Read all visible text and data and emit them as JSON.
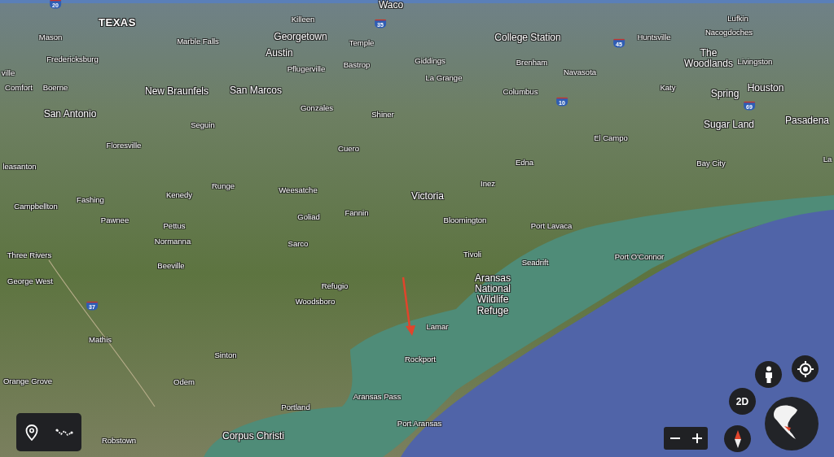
{
  "map": {
    "labels": [
      {
        "text": "TEXAS",
        "kind": "state"
      },
      {
        "text": "Waco",
        "kind": "major"
      },
      {
        "text": "Killeen",
        "kind": "city"
      },
      {
        "text": "Mason",
        "kind": "city"
      },
      {
        "text": "Marble Falls",
        "kind": "city"
      },
      {
        "text": "Georgetown",
        "kind": "major"
      },
      {
        "text": "Temple",
        "kind": "city"
      },
      {
        "text": "Austin",
        "kind": "major"
      },
      {
        "text": "Fredericksburg",
        "kind": "city"
      },
      {
        "text": "Pflugerville",
        "kind": "city"
      },
      {
        "text": "Bastrop",
        "kind": "city"
      },
      {
        "text": "ville",
        "kind": "city"
      },
      {
        "text": "Comfort",
        "kind": "city"
      },
      {
        "text": "Boerne",
        "kind": "city"
      },
      {
        "text": "New Braunfels",
        "kind": "major"
      },
      {
        "text": "San Marcos",
        "kind": "major"
      },
      {
        "text": "San Antonio",
        "kind": "major"
      },
      {
        "text": "Gonzales",
        "kind": "city"
      },
      {
        "text": "Shiner",
        "kind": "city"
      },
      {
        "text": "Seguin",
        "kind": "city"
      },
      {
        "text": "Floresville",
        "kind": "city"
      },
      {
        "text": "Cuero",
        "kind": "city"
      },
      {
        "text": "leasanton",
        "kind": "city"
      },
      {
        "text": "College Station",
        "kind": "major"
      },
      {
        "text": "Giddings",
        "kind": "city"
      },
      {
        "text": "Brenham",
        "kind": "city"
      },
      {
        "text": "Navasota",
        "kind": "city"
      },
      {
        "text": "La Grange",
        "kind": "city"
      },
      {
        "text": "Columbus",
        "kind": "city"
      },
      {
        "text": "Huntsville",
        "kind": "city"
      },
      {
        "text": "Lufkin",
        "kind": "city"
      },
      {
        "text": "Nacogdoches",
        "kind": "city"
      },
      {
        "text": "The Woodlands",
        "kind": "major"
      },
      {
        "text": "Livingston",
        "kind": "city"
      },
      {
        "text": "Katy",
        "kind": "city"
      },
      {
        "text": "Spring",
        "kind": "major"
      },
      {
        "text": "Houston",
        "kind": "major"
      },
      {
        "text": "Sugar Land",
        "kind": "major"
      },
      {
        "text": "Pasadena",
        "kind": "major"
      },
      {
        "text": "El Campo",
        "kind": "city"
      },
      {
        "text": "Edna",
        "kind": "city"
      },
      {
        "text": "Bay City",
        "kind": "city"
      },
      {
        "text": "La",
        "kind": "city"
      },
      {
        "text": "Inez",
        "kind": "city"
      },
      {
        "text": "Victoria",
        "kind": "major"
      },
      {
        "text": "Bloomington",
        "kind": "city"
      },
      {
        "text": "Port Lavaca",
        "kind": "city"
      },
      {
        "text": "Runge",
        "kind": "city"
      },
      {
        "text": "Kenedy",
        "kind": "city"
      },
      {
        "text": "Fashing",
        "kind": "city"
      },
      {
        "text": "Weesatche",
        "kind": "city"
      },
      {
        "text": "Campbellton",
        "kind": "city"
      },
      {
        "text": "Pawnee",
        "kind": "city"
      },
      {
        "text": "Goliad",
        "kind": "city"
      },
      {
        "text": "Fannin",
        "kind": "city"
      },
      {
        "text": "Pettus",
        "kind": "city"
      },
      {
        "text": "Tivoli",
        "kind": "city"
      },
      {
        "text": "Seadrift",
        "kind": "city"
      },
      {
        "text": "Port O'Connor",
        "kind": "city"
      },
      {
        "text": "Aransas National Wildlife Refuge",
        "kind": "park"
      },
      {
        "text": "Normanna",
        "kind": "city"
      },
      {
        "text": "Sarco",
        "kind": "city"
      },
      {
        "text": "Three Rivers",
        "kind": "city"
      },
      {
        "text": "George West",
        "kind": "city"
      },
      {
        "text": "Beeville",
        "kind": "city"
      },
      {
        "text": "Refugio",
        "kind": "city"
      },
      {
        "text": "Woodsboro",
        "kind": "city"
      },
      {
        "text": "Mathis",
        "kind": "city"
      },
      {
        "text": "Sinton",
        "kind": "city"
      },
      {
        "text": "Lamar",
        "kind": "city"
      },
      {
        "text": "Rockport",
        "kind": "city"
      },
      {
        "text": "Orange Grove",
        "kind": "city"
      },
      {
        "text": "Odem",
        "kind": "city"
      },
      {
        "text": "Aransas Pass",
        "kind": "city"
      },
      {
        "text": "Portland",
        "kind": "city"
      },
      {
        "text": "Port Aransas",
        "kind": "city"
      },
      {
        "text": "Robstown",
        "kind": "city"
      },
      {
        "text": "Corpus Christi",
        "kind": "major"
      }
    ],
    "shields": [
      "20",
      "35",
      "45",
      "10",
      "69",
      "37"
    ]
  },
  "view_toggle": {
    "label": "2D"
  }
}
